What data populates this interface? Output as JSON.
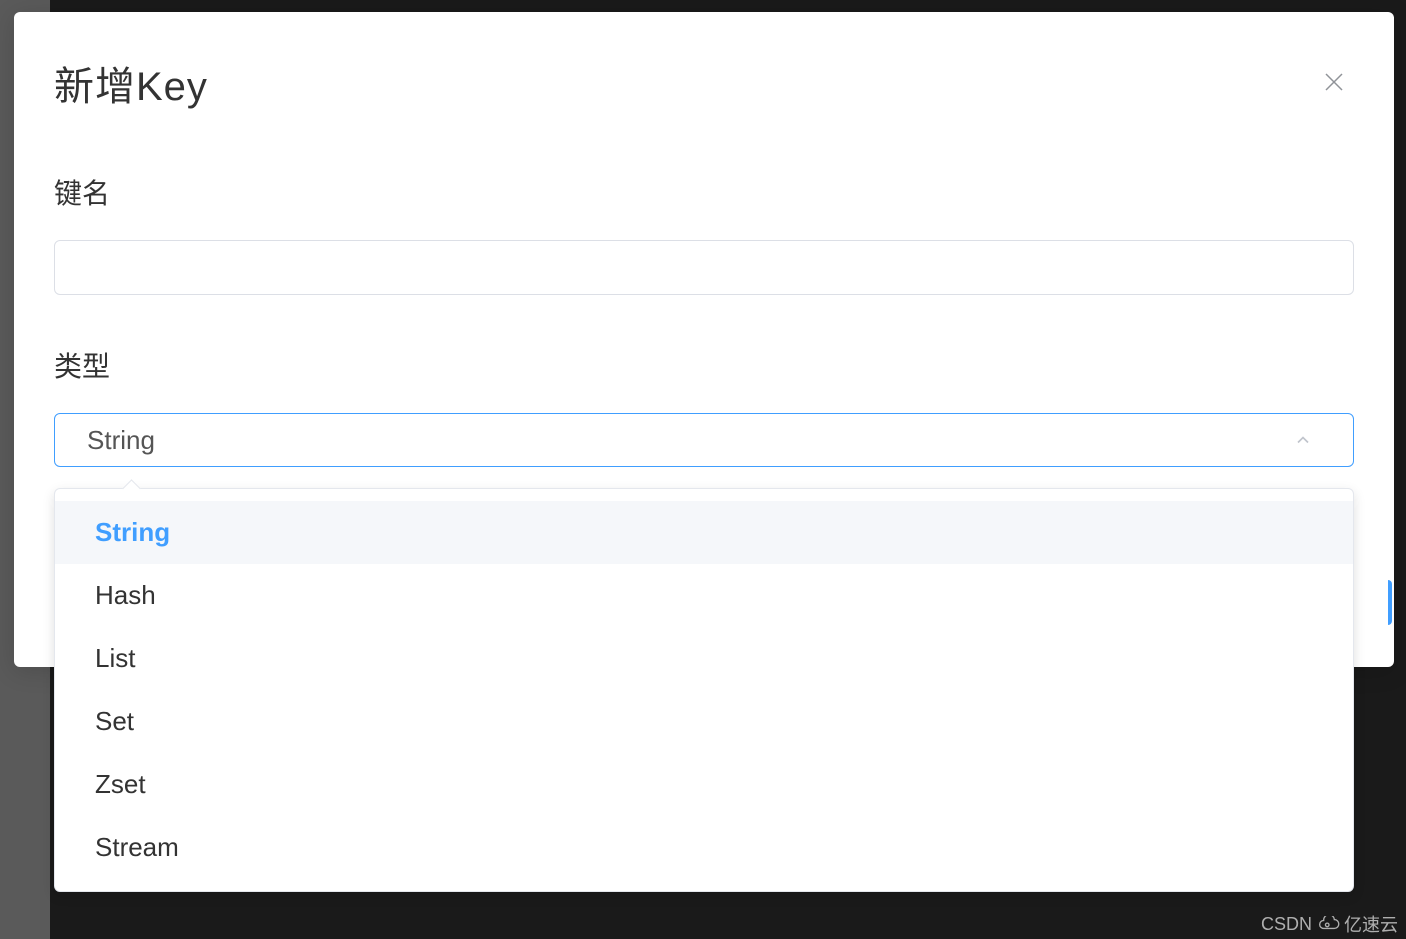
{
  "modal": {
    "title": "新增Key"
  },
  "form": {
    "keyNameLabel": "键名",
    "keyNameValue": "",
    "typeLabel": "类型",
    "typeSelected": "String",
    "typeOptions": [
      {
        "label": "String",
        "selected": true
      },
      {
        "label": "Hash",
        "selected": false
      },
      {
        "label": "List",
        "selected": false
      },
      {
        "label": "Set",
        "selected": false
      },
      {
        "label": "Zset",
        "selected": false
      },
      {
        "label": "Stream",
        "selected": false
      }
    ]
  },
  "watermark": {
    "left": "CSDN",
    "right": "亿速云"
  }
}
